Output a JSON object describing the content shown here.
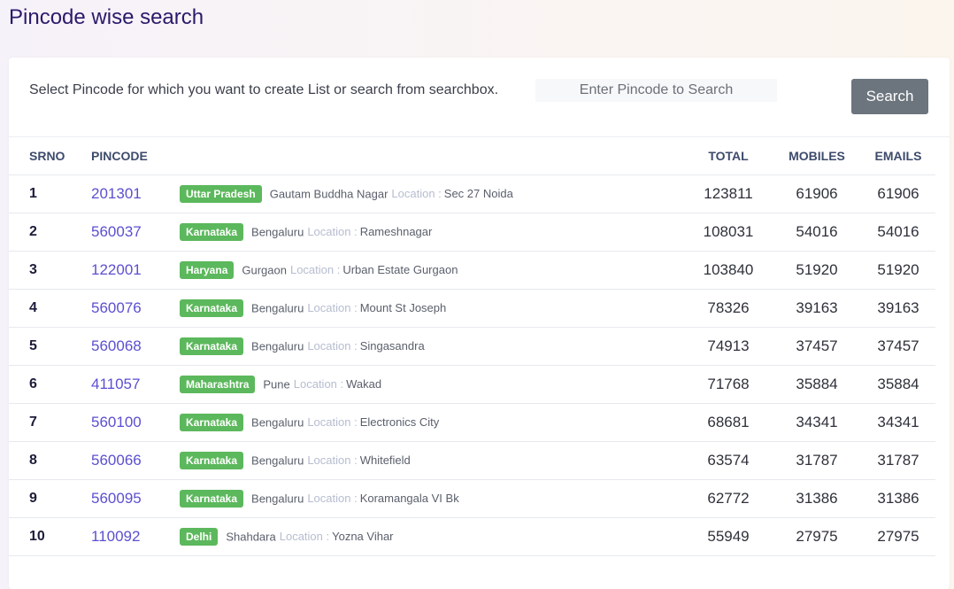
{
  "page": {
    "title": "Pincode wise search",
    "instruction": "Select Pincode for which you want to create List or search from searchbox.",
    "search_placeholder": "Enter Pincode to Search",
    "search_button": "Search"
  },
  "table": {
    "headers": {
      "srno": "SRNO",
      "pincode": "PINCODE",
      "total": "TOTAL",
      "mobiles": "MOBILES",
      "emails": "EMAILS"
    },
    "location_label": "Location :",
    "rows": [
      {
        "srno": "1",
        "pincode": "201301",
        "state": "Uttar Pradesh",
        "district": "Gautam Buddha Nagar",
        "locality": "Sec 27 Noida",
        "total": "123811",
        "mobiles": "61906",
        "emails": "61906"
      },
      {
        "srno": "2",
        "pincode": "560037",
        "state": "Karnataka",
        "district": "Bengaluru",
        "locality": "Rameshnagar",
        "total": "108031",
        "mobiles": "54016",
        "emails": "54016"
      },
      {
        "srno": "3",
        "pincode": "122001",
        "state": "Haryana",
        "district": "Gurgaon",
        "locality": "Urban Estate Gurgaon",
        "total": "103840",
        "mobiles": "51920",
        "emails": "51920"
      },
      {
        "srno": "4",
        "pincode": "560076",
        "state": "Karnataka",
        "district": "Bengaluru",
        "locality": "Mount St Joseph",
        "total": "78326",
        "mobiles": "39163",
        "emails": "39163"
      },
      {
        "srno": "5",
        "pincode": "560068",
        "state": "Karnataka",
        "district": "Bengaluru",
        "locality": "Singasandra",
        "total": "74913",
        "mobiles": "37457",
        "emails": "37457"
      },
      {
        "srno": "6",
        "pincode": "411057",
        "state": "Maharashtra",
        "district": "Pune",
        "locality": "Wakad",
        "total": "71768",
        "mobiles": "35884",
        "emails": "35884"
      },
      {
        "srno": "7",
        "pincode": "560100",
        "state": "Karnataka",
        "district": "Bengaluru",
        "locality": "Electronics City",
        "total": "68681",
        "mobiles": "34341",
        "emails": "34341"
      },
      {
        "srno": "8",
        "pincode": "560066",
        "state": "Karnataka",
        "district": "Bengaluru",
        "locality": "Whitefield",
        "total": "63574",
        "mobiles": "31787",
        "emails": "31787"
      },
      {
        "srno": "9",
        "pincode": "560095",
        "state": "Karnataka",
        "district": "Bengaluru",
        "locality": "Koramangala VI Bk",
        "total": "62772",
        "mobiles": "31386",
        "emails": "31386"
      },
      {
        "srno": "10",
        "pincode": "110092",
        "state": "Delhi",
        "district": "Shahdara",
        "locality": "Yozna Vihar",
        "total": "55949",
        "mobiles": "27975",
        "emails": "27975"
      }
    ]
  },
  "colors": {
    "title": "#2a1a6b",
    "pincode_link": "#5b4fd0",
    "state_badge": "#5cb85c",
    "search_button": "#6c757d"
  }
}
